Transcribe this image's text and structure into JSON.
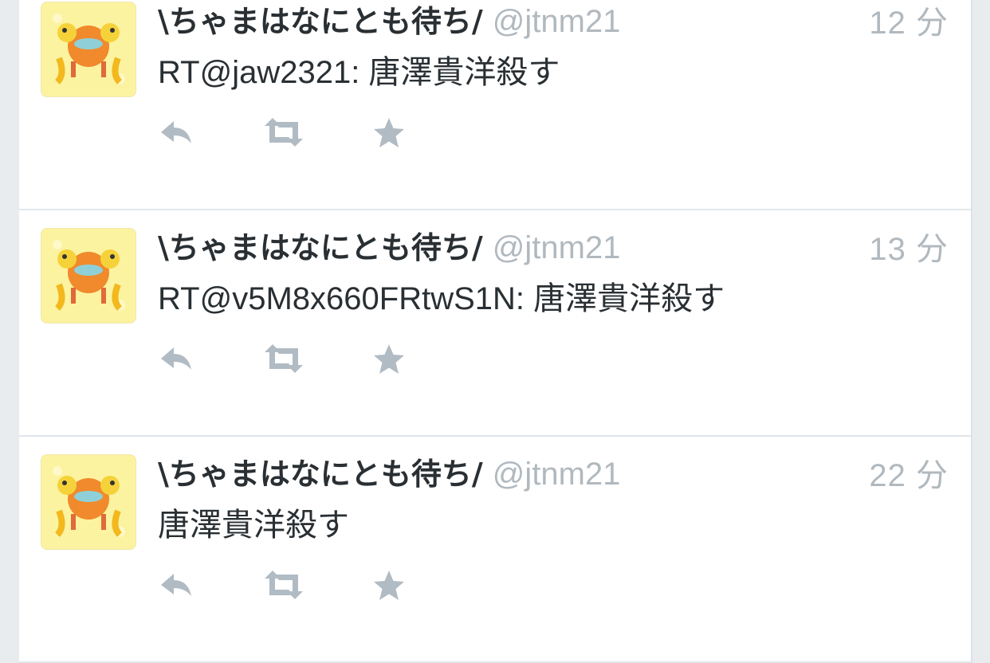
{
  "tweets": [
    {
      "name": "\\ちゃまはなにとも待ち/",
      "handle": "@jtnm21",
      "time": "12 分",
      "text": "RT@jaw2321: 唐澤貴洋殺す"
    },
    {
      "name": "\\ちゃまはなにとも待ち/",
      "handle": "@jtnm21",
      "time": "13 分",
      "text": "RT@v5M8x660FRtwS1N: 唐澤貴洋殺す"
    },
    {
      "name": "\\ちゃまはなにとも待ち/",
      "handle": "@jtnm21",
      "time": "22 分",
      "text": "唐澤貴洋殺す"
    }
  ],
  "icons": {
    "reply": "reply-icon",
    "retweet": "retweet-icon",
    "favorite": "star-icon"
  },
  "colors": {
    "name": "#292f33",
    "meta": "#b1b9bf",
    "action_icon": "#b1bbc4",
    "avatar_bg": "#fbf3a0"
  }
}
